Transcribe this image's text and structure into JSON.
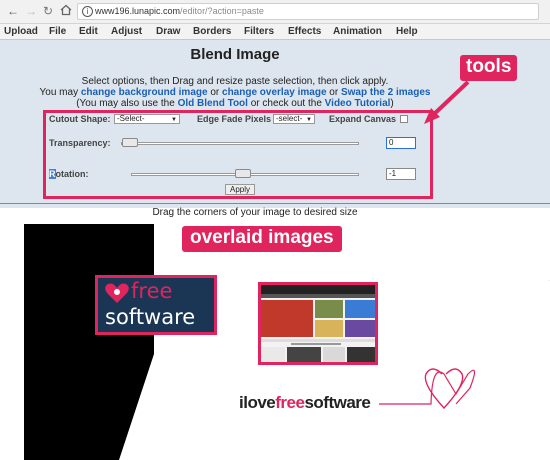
{
  "browser": {
    "url_main": "www196.lunapic.com",
    "url_rest": "/editor/?action=paste",
    "icons": [
      "back-icon",
      "forward-icon",
      "reload-icon",
      "home-icon",
      "info-icon"
    ]
  },
  "menu": [
    "Upload",
    "File",
    "Edit",
    "Adjust",
    "Draw",
    "Borders",
    "Filters",
    "Effects",
    "Animation",
    "Help"
  ],
  "page": {
    "title": "Blend Image",
    "line1": "Select options, then Drag and resize paste selection, then click apply.",
    "line2_pre": "You may ",
    "link_bg": "change background image",
    "line2_or": " or ",
    "link_overlay": "change overlay image",
    "line2_or2": " or ",
    "link_swap": "Swap the 2 images",
    "line3_pre": "(You may also use the ",
    "link_old": "Old Blend Tool",
    "line3_mid": " or check out the ",
    "link_video": "Video Tutorial",
    "line3_post": ")"
  },
  "tools": {
    "cutout_label": "Cutout Shape:",
    "cutout_value": "-Select-",
    "edge_label": "Edge Fade Pixels",
    "edge_value": "-select-",
    "expand_label": "Expand Canvas",
    "expand_checked": false,
    "transparency_label": "Transparency:",
    "transparency_value": "0",
    "rotation_label_first": "R",
    "rotation_label_rest": "otation:",
    "rotation_value": "-1",
    "apply_label": "Apply"
  },
  "drag_note": "Drag the corners of your image to desired size",
  "annotations": {
    "tools": "tools",
    "overlaid": "overlaid images"
  },
  "overlay_logo": {
    "line1": "free",
    "line2": "software"
  },
  "canvas_logo": {
    "part1": "ilove",
    "part2": "free",
    "part3": "software"
  },
  "colors": {
    "annotation": "#e0245e",
    "page_bg": "#dde6ee",
    "link": "#1a5fb4"
  }
}
